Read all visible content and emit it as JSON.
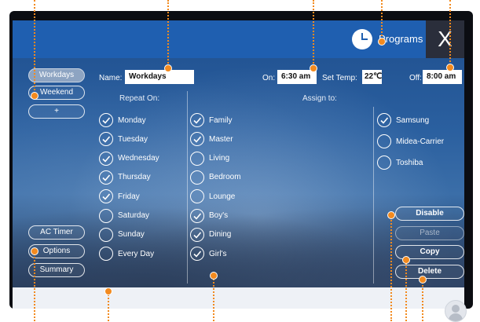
{
  "header": {
    "title": "Programs",
    "close_label": "X",
    "clock_icon": "clock-icon"
  },
  "sidebar": {
    "programs": [
      {
        "label": "Workdays",
        "active": true
      },
      {
        "label": "Weekend",
        "active": false
      },
      {
        "label": "+",
        "active": false
      }
    ],
    "bottom": [
      {
        "label": "AC Timer"
      },
      {
        "label": "Options"
      },
      {
        "label": "Summary"
      }
    ]
  },
  "form": {
    "name_label": "Name:",
    "name_value": "Workdays",
    "on_label": "On:",
    "on_value": "6:30 am",
    "set_temp_label": "Set Temp:",
    "set_temp_value": "22℃",
    "off_label": "Off:",
    "off_value": "8:00 am"
  },
  "repeat": {
    "heading": "Repeat On:",
    "days": [
      {
        "label": "Monday",
        "checked": true
      },
      {
        "label": "Tuesday",
        "checked": true
      },
      {
        "label": "Wednesday",
        "checked": true
      },
      {
        "label": "Thursday",
        "checked": true
      },
      {
        "label": "Friday",
        "checked": true
      },
      {
        "label": "Saturday",
        "checked": false
      },
      {
        "label": "Sunday",
        "checked": false
      },
      {
        "label": "Every Day",
        "checked": false
      }
    ]
  },
  "assign": {
    "heading": "Assign to:",
    "rooms": [
      {
        "label": "Family",
        "checked": true
      },
      {
        "label": "Master",
        "checked": true
      },
      {
        "label": "Living",
        "checked": false
      },
      {
        "label": "Bedroom",
        "checked": false
      },
      {
        "label": "Lounge",
        "checked": false
      },
      {
        "label": "Boy's",
        "checked": true
      },
      {
        "label": "Dining",
        "checked": true
      },
      {
        "label": "Girl's",
        "checked": true
      }
    ],
    "brands": [
      {
        "label": "Samsung",
        "checked": true
      },
      {
        "label": "Midea-Carrier",
        "checked": false
      },
      {
        "label": "Toshiba",
        "checked": false
      }
    ]
  },
  "actions": [
    {
      "label": "Disable",
      "enabled": true
    },
    {
      "label": "Paste",
      "enabled": false
    },
    {
      "label": "Copy",
      "enabled": true
    },
    {
      "label": "Delete",
      "enabled": true
    }
  ],
  "colors": {
    "header": "#1f5fb0",
    "marker": "#f28a1f",
    "close_bg": "#2a2e3b"
  }
}
